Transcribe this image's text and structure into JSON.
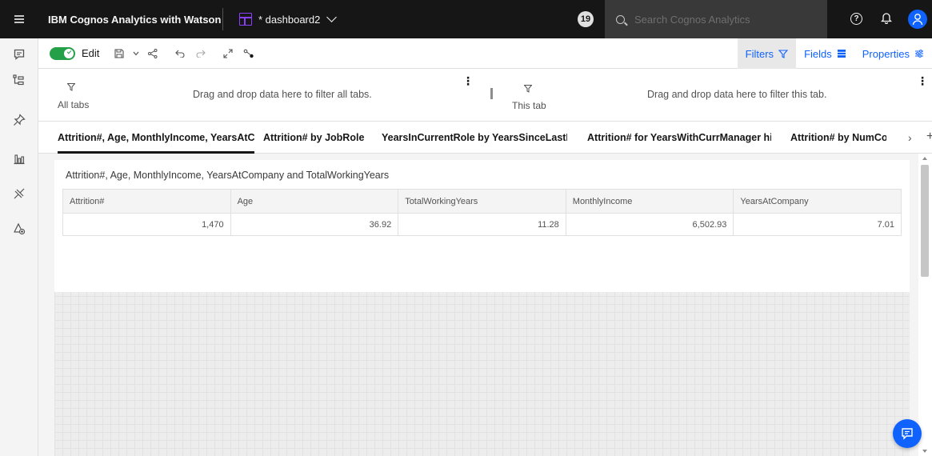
{
  "topbar": {
    "app_title": "IBM Cognos Analytics with Watson",
    "dashboard_name": "* dashboard2",
    "notification_count": "19",
    "search_placeholder": "Search Cognos Analytics",
    "help_glyph": "?"
  },
  "toolbar": {
    "edit_label": "Edit",
    "edit_on": true,
    "filters_label": "Filters",
    "fields_label": "Fields",
    "properties_label": "Properties"
  },
  "filters": {
    "all_tabs_label": "All tabs",
    "all_tabs_drop": "Drag and drop data here to filter all tabs.",
    "this_tab_label": "This tab",
    "this_tab_drop": "Drag and drop data here to filter this tab."
  },
  "tabs": [
    {
      "label": "Attrition#, Age, MonthlyIncome, YearsAtC",
      "active": true
    },
    {
      "label": "Attrition# by JobRole",
      "active": false
    },
    {
      "label": "YearsInCurrentRole by YearsSinceLastPro",
      "active": false
    },
    {
      "label": "Attrition# for YearsWithCurrManager hier",
      "active": false
    },
    {
      "label": "Attrition# by NumCo",
      "active": false
    }
  ],
  "widget": {
    "title": "Attrition#, Age, MonthlyIncome, YearsAtCompany and TotalWorkingYears",
    "columns": [
      "Attrition#",
      "Age",
      "TotalWorkingYears",
      "MonthlyIncome",
      "YearsAtCompany"
    ],
    "rows": [
      [
        "1,470",
        "36.92",
        "11.28",
        "6,502.93",
        "7.01"
      ]
    ]
  },
  "colors": {
    "accent": "#0f62fe",
    "topbar_bg": "#161616",
    "toggle_on": "#24a148",
    "dashboard_icon": "#8a3ffc"
  },
  "icons": {
    "leftrail": [
      "chat-icon",
      "data-tree-icon",
      "pin-icon",
      "visualizations-icon",
      "insights-icon",
      "widgets-icon"
    ],
    "toolbar": [
      "save-icon",
      "share-icon",
      "undo-icon",
      "redo-icon",
      "expand-icon",
      "path-icon"
    ]
  }
}
